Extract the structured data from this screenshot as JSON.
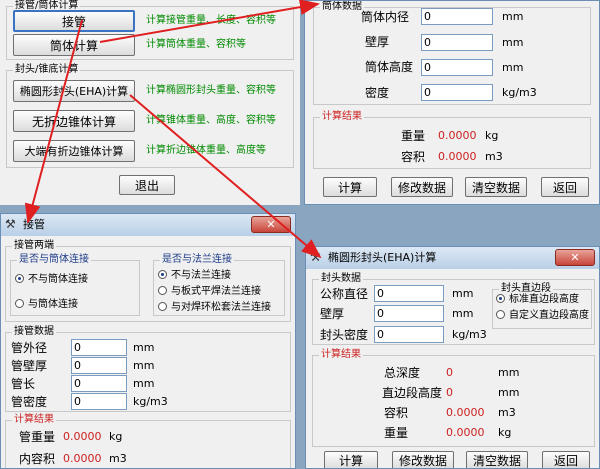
{
  "main_win": {
    "group1_title": "接管/筒体计算",
    "btn_jieguan": "接管",
    "desc_jieguan": "计算接管重量、长度、容积等",
    "btn_tongti": "筒体计算",
    "desc_tongti": "计算筒体重量、容积等",
    "group2_title": "封头/锥底计算",
    "btn_eha": "椭圆形封头(EHA)计算",
    "desc_eha": "计算椭圆形封头重量、容积等",
    "btn_cone_plain": "无折边锥体计算",
    "desc_cone_plain": "计算锥体重量、高度、容积等",
    "btn_cone_fold": "大端有折边锥体计算",
    "desc_cone_fold": "计算折边锥体重量、高度等",
    "btn_exit": "退出"
  },
  "cyl_win": {
    "group_title": "筒体数据",
    "inner_dia_label": "筒体内径",
    "inner_dia_value": "0",
    "inner_dia_unit": "mm",
    "wall_label": "壁厚",
    "wall_value": "0",
    "wall_unit": "mm",
    "height_label": "筒体高度",
    "height_value": "0",
    "height_unit": "mm",
    "density_label": "密度",
    "density_value": "0",
    "density_unit": "kg/m3",
    "result_title": "计算结果",
    "weight_label": "重量",
    "weight_value": "0.0000",
    "weight_unit": "kg",
    "volume_label": "容积",
    "volume_value": "0.0000",
    "volume_unit": "m3",
    "btn_calc": "计算",
    "btn_modify": "修改数据",
    "btn_clear": "清空数据",
    "btn_back": "返回"
  },
  "pipe_win": {
    "title": "接管",
    "close_label": "✕",
    "connect_group": "接管两端",
    "shell_group": "是否与筒体连接",
    "shell_opt1": "不与筒体连接",
    "shell_opt2": "与筒体连接",
    "flange_group": "是否与法兰连接",
    "flange_opt1": "不与法兰连接",
    "flange_opt2": "与板式平焊法兰连接",
    "flange_opt3": "与对焊环松套法兰连接",
    "data_group": "接管数据",
    "od_label": "管外径",
    "od_value": "0",
    "od_unit": "mm",
    "wall_label": "管壁厚",
    "wall_value": "0",
    "wall_unit": "mm",
    "len_label": "管长",
    "len_value": "0",
    "len_unit": "mm",
    "density_label": "管密度",
    "density_value": "0",
    "density_unit": "kg/m3",
    "result_title": "计算结果",
    "weight_label": "管重量",
    "weight_value": "0.0000",
    "weight_unit": "kg",
    "volume_label": "内容积",
    "volume_value": "0.0000",
    "volume_unit": "m3"
  },
  "eha_win": {
    "title": "椭圆形封头(EHA)计算",
    "close_label": "✕",
    "data_group": "封头数据",
    "dn_label": "公称直径",
    "dn_value": "0",
    "dn_unit": "mm",
    "wall_label": "壁厚",
    "wall_value": "0",
    "wall_unit": "mm",
    "density_label": "封头密度",
    "density_value": "0",
    "density_unit": "kg/m3",
    "straight_group": "封头直边段",
    "straight_opt1": "标准直边段高度",
    "straight_opt2": "自定义直边段高度",
    "result_title": "计算结果",
    "depth_label": "总深度",
    "depth_value": "0",
    "depth_unit": "mm",
    "straight_label": "直边段高度",
    "straight_value": "0",
    "straight_unit": "mm",
    "volume_label": "容积",
    "volume_value": "0.0000",
    "volume_unit": "m3",
    "weight_label": "重量",
    "weight_value": "0.0000",
    "weight_unit": "kg",
    "btn_calc": "计算",
    "btn_modify": "修改数据",
    "btn_clear": "清空数据",
    "btn_back": "返回"
  },
  "colors": {
    "arrow": "#e02020",
    "result_text": "#cc2222",
    "desc_text": "#008a00"
  }
}
